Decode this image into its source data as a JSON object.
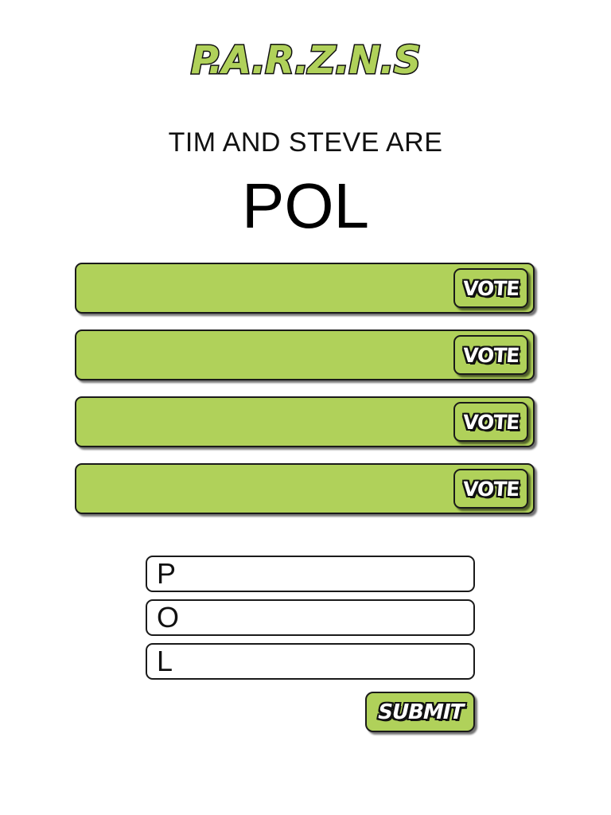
{
  "logo": {
    "text": "P.A.R.Z.N.S",
    "fill_color": "#b0d15a",
    "outline_color": "#111111"
  },
  "prompt": {
    "text": "TIM AND STEVE ARE"
  },
  "acronym": {
    "text": "POL"
  },
  "answers": [
    {
      "text": "",
      "vote_label": "VOTE"
    },
    {
      "text": "",
      "vote_label": "VOTE"
    },
    {
      "text": "",
      "vote_label": "VOTE"
    },
    {
      "text": "",
      "vote_label": "VOTE"
    }
  ],
  "entry": {
    "inputs": [
      {
        "value": "P"
      },
      {
        "value": "O"
      },
      {
        "value": "L"
      }
    ],
    "submit_label": "SUBMIT"
  },
  "colors": {
    "accent_green": "#b0d15a",
    "outline": "#1a1a1a",
    "background": "#ffffff"
  }
}
